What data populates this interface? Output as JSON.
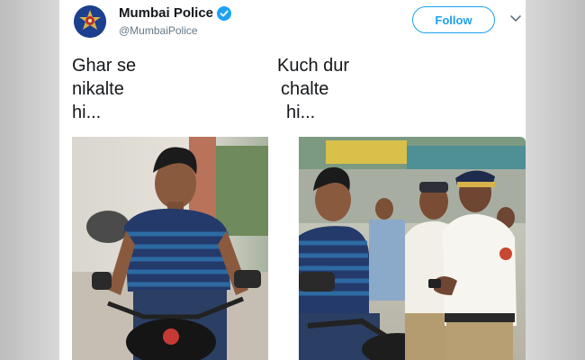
{
  "account": {
    "display_name": "Mumbai Police",
    "handle": "@MumbaiPolice",
    "verified": true,
    "avatar_icon": "police-badge-icon"
  },
  "actions": {
    "follow_label": "Follow",
    "menu_icon": "chevron-down-icon"
  },
  "tweet": {
    "left_caption": [
      "Ghar se",
      "nikalte",
      "hi..."
    ],
    "right_caption": [
      "Kuch dur",
      "chalte",
      "hi..."
    ]
  },
  "colors": {
    "accent": "#1da1f2",
    "text": "#14171a",
    "secondary_text": "#657786"
  },
  "media": {
    "left_photo": "young man riding motorcycle",
    "right_photo": "young man on motorcycle stopped by traffic police"
  }
}
